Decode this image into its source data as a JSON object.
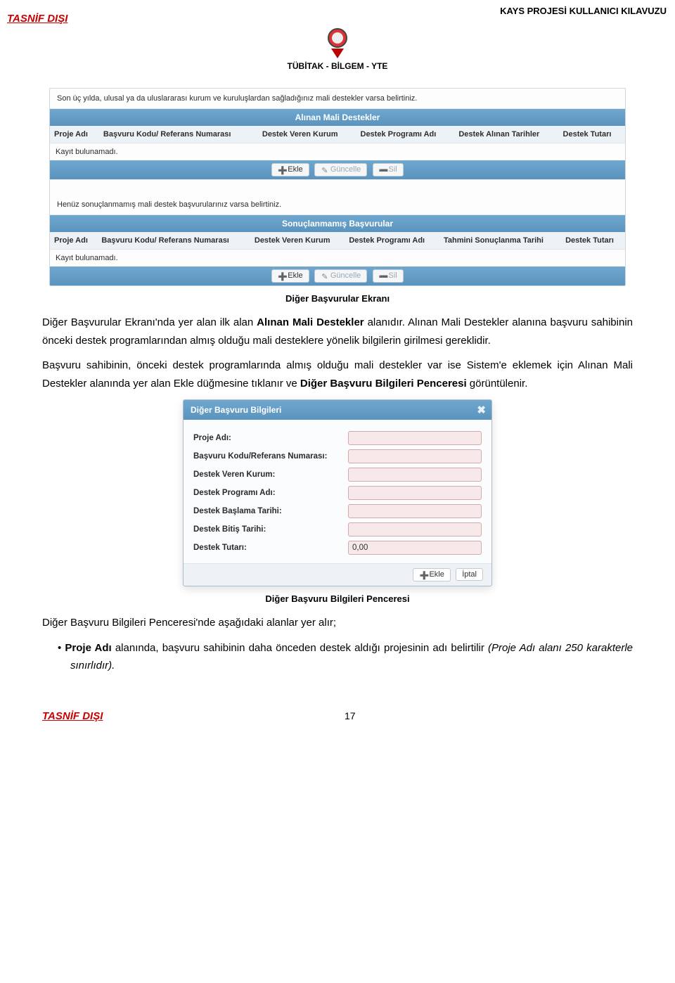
{
  "header": {
    "left": "TASNİF DIŞI",
    "right": "KAYS PROJESİ KULLANICI KILAVUZU",
    "sub": "TÜBİTAK - BİLGEM - YTE"
  },
  "panel1": {
    "note": "Son üç yılda, ulusal ya da uluslararası kurum ve kuruluşlardan sağladığınız mali destekler varsa belirtiniz.",
    "title": "Alınan Mali Destekler",
    "cols": [
      "Proje Adı",
      "Başvuru Kodu/ Referans Numarası",
      "Destek Veren Kurum",
      "Destek Programı Adı",
      "Destek Alınan Tarihler",
      "Destek Tutarı"
    ],
    "empty": "Kayıt bulunamadı.",
    "btn_add": "Ekle",
    "btn_upd": "Güncelle",
    "btn_del": "Sil"
  },
  "panel2": {
    "note": "Henüz sonuçlanmamış mali destek başvurularınız varsa belirtiniz.",
    "title": "Sonuçlanmamış Başvurular",
    "cols": [
      "Proje Adı",
      "Başvuru Kodu/ Referans Numarası",
      "Destek Veren Kurum",
      "Destek Programı Adı",
      "Tahmini Sonuçlanma Tarihi",
      "Destek Tutarı"
    ],
    "empty": "Kayıt bulunamadı.",
    "btn_add": "Ekle",
    "btn_upd": "Güncelle",
    "btn_del": "Sil"
  },
  "caption1": "Diğer Başvurular Ekranı",
  "para1a": "Diğer Başvurular Ekranı'nda yer alan ilk alan ",
  "para1b": "Alınan Mali Destekler",
  "para1c": " alanıdır. Alınan Mali Destekler alanına başvuru sahibinin önceki destek programlarından almış olduğu mali desteklere yönelik bilgilerin girilmesi gereklidir.",
  "para2a": "Başvuru sahibinin, önceki destek programlarında almış olduğu mali destekler var ise Sistem'e eklemek için Alınan Mali Destekler alanında yer alan Ekle düğmesine tıklanır ve ",
  "para2b": "Diğer Başvuru Bilgileri Penceresi",
  "para2c": " görüntülenir.",
  "dialog": {
    "title": "Diğer Başvuru Bilgileri",
    "fields": {
      "f1": "Proje Adı:",
      "f2": "Başvuru Kodu/Referans Numarası:",
      "f3": "Destek Veren Kurum:",
      "f4": "Destek Programı Adı:",
      "f5": "Destek Başlama Tarihi:",
      "f6": "Destek Bitiş Tarihi:",
      "f7": "Destek Tutarı:"
    },
    "tutar_val": "0,00",
    "btn_add": "Ekle",
    "btn_cancel": "İptal"
  },
  "caption2": "Diğer Başvuru Bilgileri Penceresi",
  "para3": "Diğer Başvuru Bilgileri Penceresi'nde aşağıdaki alanlar yer alır;",
  "bullet1a": "Proje Adı",
  "bullet1b": " alanında, başvuru sahibinin daha önceden destek aldığı projesinin adı belirtilir ",
  "bullet1c": "(Proje Adı alanı 250 karakterle sınırlıdır).",
  "footer_left": "TASNİF DIŞI",
  "footer_page": "17"
}
